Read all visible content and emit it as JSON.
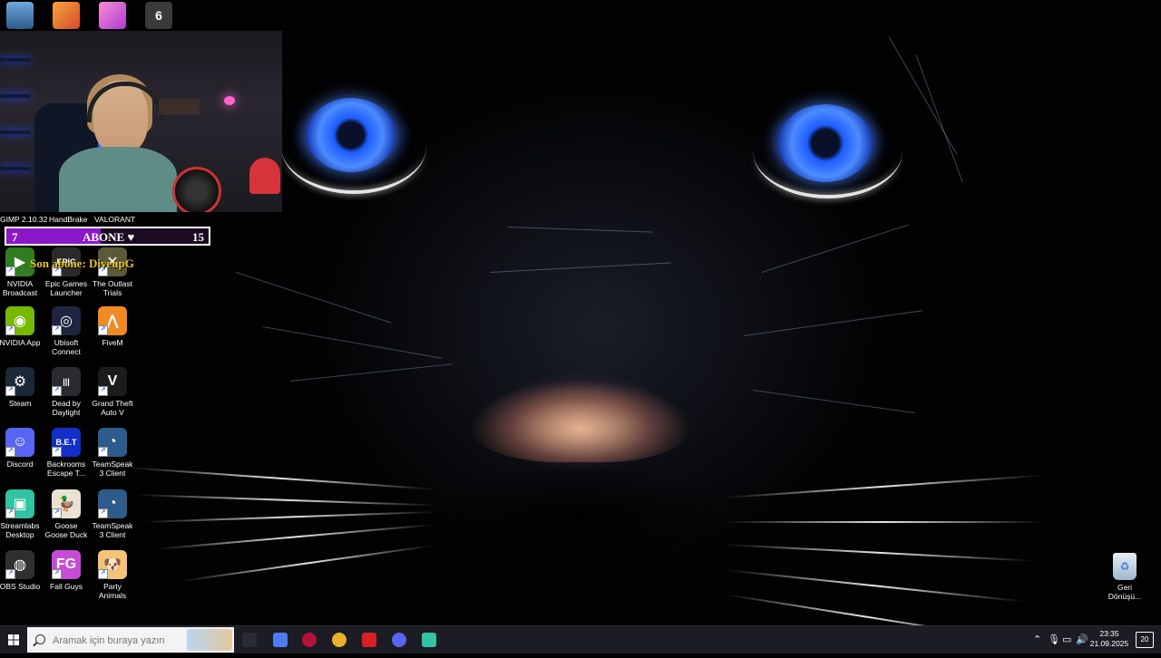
{
  "desktop": {
    "top_row_labels": [
      "GIMP 2.10.32",
      "HandBrake",
      "VALORANT"
    ],
    "icons": [
      {
        "id": "nvidia-broadcast",
        "label": "NVIDIA Broadcast",
        "color": "#2f7d1e",
        "glyph": "▶"
      },
      {
        "id": "epic-games",
        "label": "Epic Games Launcher",
        "color": "#2a2a2a",
        "glyph": "EPIC"
      },
      {
        "id": "outlast-trials",
        "label": "The Outlast Trials",
        "color": "#5a5a3a",
        "glyph": "✕"
      },
      {
        "id": "nvidia-app",
        "label": "NVIDIA App",
        "color": "#76b900",
        "glyph": "◉"
      },
      {
        "id": "ubisoft-connect",
        "label": "Ubisoft Connect",
        "color": "#1f2540",
        "glyph": "◎"
      },
      {
        "id": "fivem",
        "label": "FiveM",
        "color": "#f08a24",
        "glyph": "⋀"
      },
      {
        "id": "steam",
        "label": "Steam",
        "color": "#1b2838",
        "glyph": "⚙"
      },
      {
        "id": "dead-by-daylight",
        "label": "Dead by Daylight",
        "color": "#2a2a30",
        "glyph": "|||"
      },
      {
        "id": "gta-v",
        "label": "Grand Theft Auto V",
        "color": "#1c1c1c",
        "glyph": "V"
      },
      {
        "id": "discord",
        "label": "Discord",
        "color": "#5865f2",
        "glyph": "☺"
      },
      {
        "id": "backrooms",
        "label": "Backrooms Escape T...",
        "color": "#1230c8",
        "glyph": "B.E.T"
      },
      {
        "id": "teamspeak-3a",
        "label": "TeamSpeak 3 Client",
        "color": "#2c5b8c",
        "glyph": "◔"
      },
      {
        "id": "streamlabs",
        "label": "Streamlabs Desktop",
        "color": "#31c3a2",
        "glyph": "▣"
      },
      {
        "id": "goose-goose-duck",
        "label": "Goose Goose Duck",
        "color": "#e9e2d3",
        "glyph": "🦆"
      },
      {
        "id": "teamspeak-3b",
        "label": "TeamSpeak 3 Client",
        "color": "#2c5b8c",
        "glyph": "◔"
      },
      {
        "id": "obs-studio",
        "label": "OBS Studio",
        "color": "#302e31",
        "glyph": "◍"
      },
      {
        "id": "fall-guys",
        "label": "Fall Guys",
        "color": "#c84bd6",
        "glyph": "FG"
      },
      {
        "id": "party-animals",
        "label": "Party Animals",
        "color": "#f3c37a",
        "glyph": "🐶"
      }
    ],
    "recycle_bin": {
      "label": "Geri Dönüşü..."
    }
  },
  "stream_overlay": {
    "sub_goal": {
      "current": "7",
      "label": "ABONE ♥",
      "target": "15",
      "progress": 0.4667
    },
    "last_sub": "Son abone: DiveupG"
  },
  "taskbar": {
    "search_placeholder": "Aramak için buraya yazın",
    "clock_time": "23:35",
    "clock_date": "21.09.2025",
    "notification_count": "20",
    "apps": [
      {
        "id": "task-view",
        "color": "#2b2b36"
      },
      {
        "id": "copilot",
        "color": "#4f7bf3"
      },
      {
        "id": "opera-gx",
        "color": "#b3123c"
      },
      {
        "id": "chrome",
        "color": "#e8b12a"
      },
      {
        "id": "netflix",
        "color": "#d81f26"
      },
      {
        "id": "discord-task",
        "color": "#5865f2"
      },
      {
        "id": "streamlabs-task",
        "color": "#31c3a2"
      }
    ]
  }
}
